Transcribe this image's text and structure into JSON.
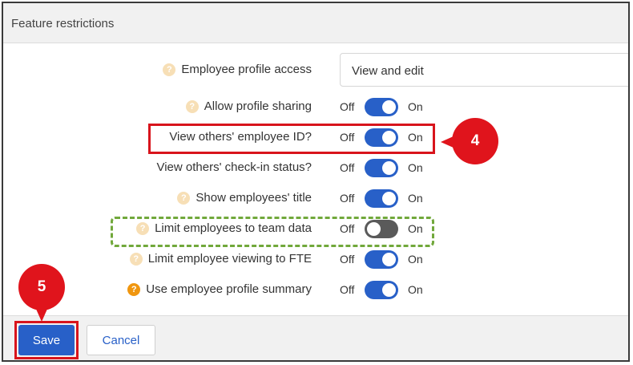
{
  "panel": {
    "title": "Feature restrictions"
  },
  "profile_access": {
    "label": "Employee profile access",
    "value": "View and edit",
    "help": "?"
  },
  "toggle_text": {
    "off": "Off",
    "on": "On"
  },
  "settings": [
    {
      "label": "Allow profile sharing",
      "help": "?",
      "enabled": true
    },
    {
      "label": "View others' employee ID?",
      "help": "",
      "enabled": true
    },
    {
      "label": "View others' check-in status?",
      "help": "",
      "enabled": true
    },
    {
      "label": "Show employees' title",
      "help": "?",
      "enabled": true
    },
    {
      "label": "Limit employees to team data",
      "help": "?",
      "enabled": false
    },
    {
      "label": "Limit employee viewing to FTE",
      "help": "?",
      "enabled": true
    },
    {
      "label": "Use employee profile summary",
      "help": "?",
      "enabled": true
    }
  ],
  "annotations": {
    "step4": "4",
    "step5": "5"
  },
  "footer": {
    "save": "Save",
    "cancel": "Cancel"
  },
  "colors": {
    "accent": "#2860c8",
    "highlight_red": "#d8141c",
    "highlight_green": "#71a83b",
    "toggle_off": "#5a5a5a"
  }
}
